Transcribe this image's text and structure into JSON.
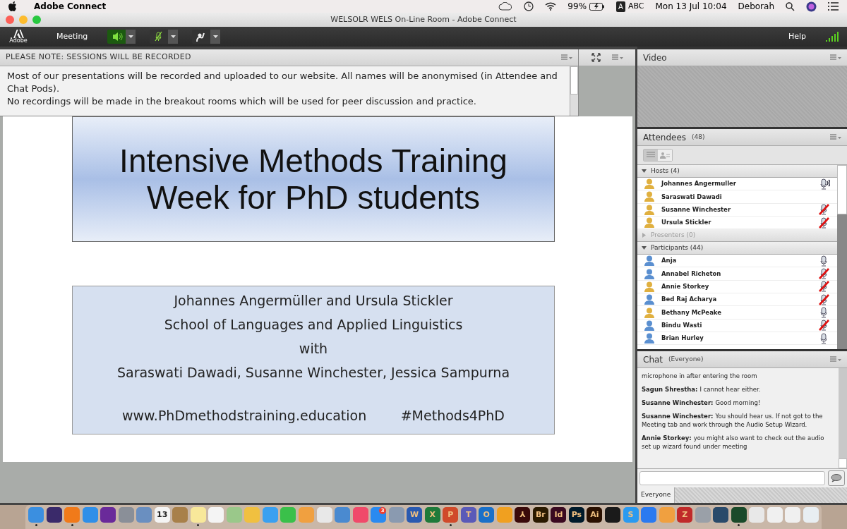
{
  "menubar": {
    "app": "Adobe Connect",
    "battery": "99%",
    "input_letter": "A",
    "input_source": "ABC",
    "clock": "Mon 13 Jul 10:04",
    "user": "Deborah"
  },
  "window": {
    "title": "WELSOLR WELS On-Line Room - Adobe Connect"
  },
  "toolbar": {
    "logo_text": "Adobe",
    "menu": "Meeting",
    "help": "Help",
    "speaker_on": true,
    "mic_on": false
  },
  "note_pod": {
    "title": "PLEASE NOTE: SESSIONS WILL BE RECORDED",
    "lines": [
      "Most of our presentations will be recorded and uploaded to our website. All names will be anonymised (in Attendee and Chat Pods).",
      "No recordings will be made in the breakout rooms which will be used for peer discussion and practice."
    ]
  },
  "slide": {
    "title_lines": [
      "Intensive Methods Training",
      "Week for PhD students"
    ],
    "info_lines": [
      "Johannes Angermüller and Ursula Stickler",
      "School of Languages and Applied Linguistics",
      "with",
      "Saraswati Dawadi, Susanne Winchester, Jessica Sampurna"
    ],
    "website": "www.PhDmethodstraining.education",
    "hashtag": "#Methods4PhD"
  },
  "video_pod": {
    "title": "Video"
  },
  "attendees_pod": {
    "title": "Attendees",
    "count": "(48)",
    "groups": [
      {
        "label": "Hosts (4)",
        "expanded": true,
        "people": [
          {
            "name": "Johannes Angermuller",
            "color": "#e0b040",
            "mic": true,
            "muted": false,
            "speaking": true
          },
          {
            "name": "Saraswati Dawadi",
            "color": "#e0b040",
            "mic": false
          },
          {
            "name": "Susanne Winchester",
            "color": "#e0b040",
            "mic": true,
            "muted": true,
            "speaking": false
          },
          {
            "name": "Ursula Stickler",
            "color": "#e0b040",
            "mic": true,
            "muted": true,
            "speaking": false
          }
        ]
      },
      {
        "label": "Presenters (0)",
        "expanded": false
      },
      {
        "label": "Participants (44)",
        "expanded": true,
        "people": [
          {
            "name": "Anja",
            "color": "#5a8fd0",
            "mic": true,
            "muted": false,
            "speaking": false
          },
          {
            "name": "Annabel Richeton",
            "color": "#5a8fd0",
            "mic": true,
            "muted": true,
            "speaking": false
          },
          {
            "name": "Annie Storkey",
            "color": "#e0b040",
            "mic": true,
            "muted": true,
            "speaking": false
          },
          {
            "name": "Bed Raj Acharya",
            "color": "#5a8fd0",
            "mic": true,
            "muted": true,
            "speaking": false
          },
          {
            "name": "Bethany McPeake",
            "color": "#e0b040",
            "mic": true,
            "muted": false,
            "speaking": false
          },
          {
            "name": "Bindu Wasti",
            "color": "#5a8fd0",
            "mic": true,
            "muted": true,
            "speaking": false
          },
          {
            "name": "Brian Hurley",
            "color": "#5a8fd0",
            "mic": true,
            "muted": false,
            "speaking": false
          }
        ]
      }
    ],
    "views": [
      {
        "selected": true
      },
      {
        "selected": false
      }
    ]
  },
  "chat_pod": {
    "title": "Chat",
    "scope": "(Everyone)",
    "messages": [
      {
        "text": "microphone in after entering the room"
      },
      {
        "author": "Sagun Shrestha:",
        "text": "I cannot hear either."
      },
      {
        "author": "Susanne Winchester:",
        "text": "Good morning!"
      },
      {
        "author": "Susanne Winchester:",
        "text": "You should hear us. If  not got to the Meeting tab and work through the Audio Setup Wizard."
      },
      {
        "author": "Annie Storkey:",
        "text": "you might also want to check out the audio set up wizard found under meeting"
      }
    ],
    "tab": "Everyone"
  },
  "dock": [
    {
      "color": "#3b8fe0",
      "running": true
    },
    {
      "color": "#3a2a6a",
      "running": false
    },
    {
      "color": "#f07a1a",
      "running": true
    },
    {
      "color": "#2f8fe8",
      "running": false
    },
    {
      "color": "#6a2a9a",
      "running": false
    },
    {
      "color": "#8a8f98",
      "running": false
    },
    {
      "color": "#6a8fc0",
      "running": false
    },
    {
      "color": "#f4f4f4",
      "label": "13",
      "running": false
    },
    {
      "color": "#a8804a",
      "running": false
    },
    {
      "color": "#f8e89a",
      "running": true
    },
    {
      "color": "#f4f4f4",
      "running": false
    },
    {
      "color": "#9ac88a",
      "running": false
    },
    {
      "color": "#f0c040",
      "running": false
    },
    {
      "color": "#3aa0f0",
      "running": false
    },
    {
      "color": "#3ac04a",
      "running": false
    },
    {
      "color": "#f0a040",
      "running": false
    },
    {
      "color": "#e8e8e8",
      "running": false
    },
    {
      "color": "#4a8ad0",
      "running": false
    },
    {
      "color": "#f04a6a",
      "running": false
    },
    {
      "color": "#2a8af0",
      "badge": "3",
      "running": false
    },
    {
      "color": "#8a9ab0",
      "running": false
    },
    {
      "color": "#2a5ab0",
      "label": "W",
      "running": false
    },
    {
      "color": "#1f7a3a",
      "label": "X",
      "running": false
    },
    {
      "color": "#d04a2a",
      "label": "P",
      "running": true
    },
    {
      "color": "#5a5ab8",
      "label": "T",
      "running": false
    },
    {
      "color": "#1a70c8",
      "label": "O",
      "running": false
    },
    {
      "color": "#f0a020",
      "running": false
    },
    {
      "color": "#3a0a0a",
      "label": "⅄",
      "running": false
    },
    {
      "color": "#2a1a00",
      "label": "Br",
      "running": false
    },
    {
      "color": "#3a0a20",
      "label": "Id",
      "running": false
    },
    {
      "color": "#001a2a",
      "label": "Ps",
      "running": false
    },
    {
      "color": "#2a1000",
      "label": "Ai",
      "running": false
    },
    {
      "color": "#1a1a1a",
      "running": false
    },
    {
      "color": "#2a9af0",
      "label": "S",
      "running": false
    },
    {
      "color": "#2a7af0",
      "running": false
    },
    {
      "color": "#f0a040",
      "running": false
    },
    {
      "color": "#c02a2a",
      "label": "Z",
      "running": false
    },
    {
      "color": "#9aa0a8",
      "running": false
    },
    {
      "color": "#2a4a6a",
      "running": false
    },
    {
      "color": "#1a4a2a",
      "running": true
    },
    {
      "color": "#e8e8e8",
      "running": false
    },
    {
      "color": "#f0f0f0",
      "running": false
    },
    {
      "color": "#f0f0f0",
      "running": false
    },
    {
      "color": "#e8eef2",
      "running": false
    }
  ]
}
